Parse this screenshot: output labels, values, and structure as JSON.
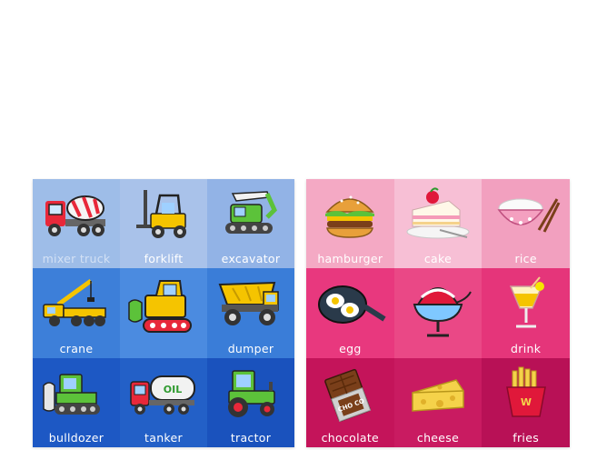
{
  "vehicles": {
    "items": [
      {
        "label": "mixer truck",
        "bg": "#9ebde8"
      },
      {
        "label": "forklift",
        "bg": "#a9c2ea"
      },
      {
        "label": "excavator",
        "bg": "#92b3e6"
      },
      {
        "label": "crane",
        "bg": "#3d7fd9"
      },
      {
        "label": "",
        "bg": "#4b8be0"
      },
      {
        "label": "dumper",
        "bg": "#3a7dd8"
      },
      {
        "label": "bulldozer",
        "bg": "#1d58c4"
      },
      {
        "label": "tanker",
        "bg": "#2360c7"
      },
      {
        "label": "tractor",
        "bg": "#1a52bd"
      }
    ],
    "tanker_text": "OIL"
  },
  "foods": {
    "items": [
      {
        "label": "hamburger",
        "bg": "#f4a9c4"
      },
      {
        "label": "cake",
        "bg": "#f7bfd5"
      },
      {
        "label": "rice",
        "bg": "#f2a0bf"
      },
      {
        "label": "egg",
        "bg": "#e8387e"
      },
      {
        "label": "",
        "bg": "#ea4886"
      },
      {
        "label": "drink",
        "bg": "#e5357a"
      },
      {
        "label": "chocolate",
        "bg": "#c4145a"
      },
      {
        "label": "cheese",
        "bg": "#c91b61"
      },
      {
        "label": "fries",
        "bg": "#b81156"
      }
    ],
    "choco_text": "CHO CO",
    "fries_text": "W"
  }
}
